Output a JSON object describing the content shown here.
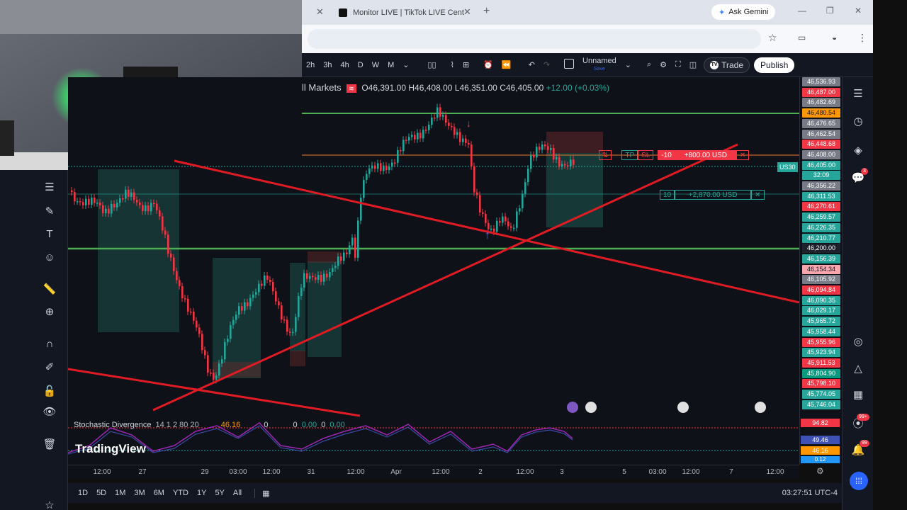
{
  "browser": {
    "tab_title": "Monitor LIVE | TikTok LIVE Cent",
    "gemini_label": "Ask Gemini"
  },
  "toolbar": {
    "intervals": [
      "2h",
      "3h",
      "4h",
      "D",
      "W",
      "M"
    ],
    "layout_name": "Unnamed",
    "layout_status": "Save",
    "trade_label": "Trade",
    "publish_label": "Publish"
  },
  "symbol": {
    "market_label": "ll Markets",
    "open": "O46,391.00",
    "high": "H46,408.00",
    "low": "L46,351.00",
    "close": "C46,405.00",
    "change": "+12.00 (+0.03%)"
  },
  "orders": {
    "position_qty": "-10",
    "position_pnl": "+800.00 USD",
    "tp_label": "TP",
    "sl_label": "SL",
    "tp_order_qty": "10",
    "tp_order_pnl": "+2,870.00 USD",
    "reverse_label": "⇅"
  },
  "symbol_tag": "US30",
  "price_labels": [
    {
      "text": "46,536.93",
      "bg": "#787b86"
    },
    {
      "text": "46,487.00",
      "bg": "#f23645"
    },
    {
      "text": "46,482.69",
      "bg": "#787b86"
    },
    {
      "text": "46,480.54",
      "bg": "#ff9800",
      "fg": "#131722"
    },
    {
      "text": "46,476.65",
      "bg": "#787b86"
    },
    {
      "text": "46,462.54",
      "bg": "#787b86"
    },
    {
      "text": "46,448.68",
      "bg": "#f23645"
    },
    {
      "text": "46,408.00",
      "bg": "#787b86"
    },
    {
      "text": "46,405.00",
      "bg": "#26a69a"
    },
    {
      "text": "32:09",
      "bg": "#26a69a"
    },
    {
      "text": "46,356.22",
      "bg": "#787b86"
    },
    {
      "text": "46,311.53",
      "bg": "#26a69a"
    },
    {
      "text": "46,270.61",
      "bg": "#f23645"
    },
    {
      "text": "46,259.57",
      "bg": "#26a69a"
    },
    {
      "text": "46,226.35",
      "bg": "#26a69a"
    },
    {
      "text": "46,210.77",
      "bg": "#26a69a"
    },
    {
      "text": "46,200.00",
      "bg": "#1e222d"
    },
    {
      "text": "46,156.39",
      "bg": "#26a69a"
    },
    {
      "text": "46,154.34",
      "bg": "#f7a6ad",
      "fg": "#131722"
    },
    {
      "text": "46,105.92",
      "bg": "#787b86"
    },
    {
      "text": "46,094.84",
      "bg": "#f23645"
    },
    {
      "text": "46,090.35",
      "bg": "#26a69a"
    },
    {
      "text": "46,029.17",
      "bg": "#26a69a"
    },
    {
      "text": "45,965.72",
      "bg": "#26a69a"
    },
    {
      "text": "45,958.44",
      "bg": "#26a69a"
    },
    {
      "text": "45,955.96",
      "bg": "#f23645"
    },
    {
      "text": "45,923.94",
      "bg": "#26a69a"
    },
    {
      "text": "45,911.53",
      "bg": "#f23645"
    },
    {
      "text": "45,804.90",
      "bg": "#089981"
    },
    {
      "text": "45,798.10",
      "bg": "#f23645"
    },
    {
      "text": "45,774.05",
      "bg": "#26a69a"
    },
    {
      "text": "45,746.04",
      "bg": "#26a69a"
    }
  ],
  "indicator": {
    "name": "Stochastic Divergence",
    "params": "14 1 2 80 20",
    "value": "46.16",
    "v1": "0",
    "v2": "0",
    "v3": "0.00",
    "v4": "0.00",
    "labels_upper": [
      "94.82"
    ],
    "labels_lower": [
      "49.46",
      "46.16",
      "0.12"
    ]
  },
  "brand": "TradingView",
  "time_axis": [
    "12:00",
    "27",
    "29",
    "03:00",
    "12:00",
    "31",
    "12:00",
    "Apr",
    "12:00",
    "2",
    "12:00",
    "3",
    "5",
    "03:00",
    "12:00",
    "7",
    "12:00"
  ],
  "ranges": [
    "1D",
    "5D",
    "1M",
    "3M",
    "6M",
    "YTD",
    "1Y",
    "5Y",
    "All"
  ],
  "clock": "03:27:51 UTC-4",
  "badges": {
    "alerts": "3",
    "notifications": "99+",
    "messages": "99"
  },
  "colors": {
    "up": "#26a69a",
    "down": "#f23645",
    "trendline": "#e01b24",
    "level": "#4caf50",
    "bg": "#0e1118"
  }
}
